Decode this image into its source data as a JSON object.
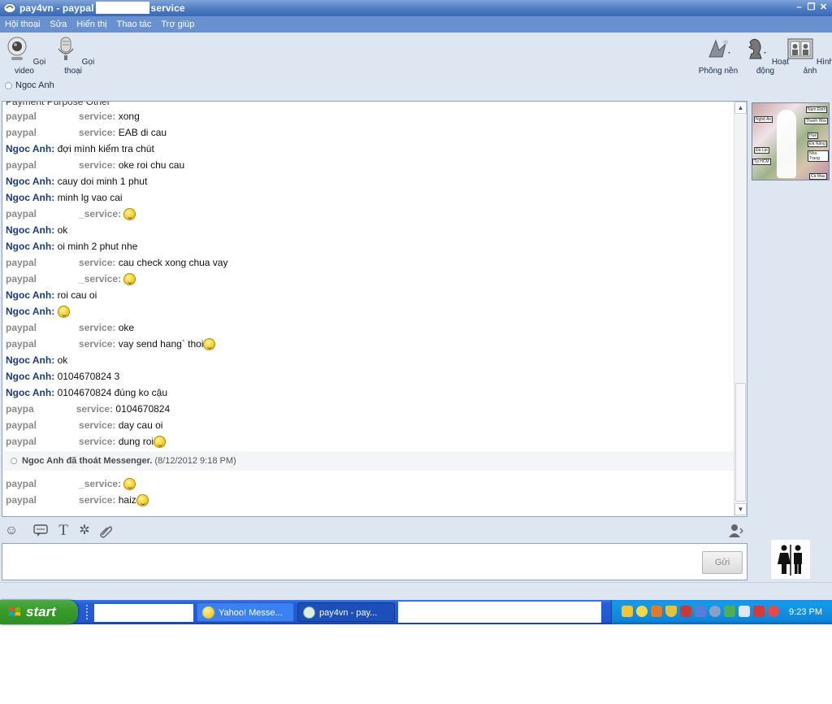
{
  "window": {
    "title": "pay4vn - paypal",
    "title_suffix": "service"
  },
  "menu": [
    "Hội thoại",
    "Sửa",
    "Hiển thị",
    "Thao tác",
    "Trợ giúp"
  ],
  "toolbar": {
    "video_call": "Gọi video",
    "voice_call": "Gọi thoại",
    "background": "Phông nền",
    "activities": "Hoạt động",
    "photos": "Hình ảnh"
  },
  "contact": {
    "name": "Ngoc Anh"
  },
  "conversation": {
    "partial_top": "Payment Purpose Other",
    "messages": [
      {
        "who": "peer",
        "sender": "paypal",
        "suffix": "service:",
        "text": "xong"
      },
      {
        "who": "peer",
        "sender": "paypal",
        "suffix": "service:",
        "text": "EAB di cau"
      },
      {
        "who": "me",
        "sender": "Ngoc Anh:",
        "text": "đợi mình kiểm tra chút"
      },
      {
        "who": "peer",
        "sender": "paypal",
        "suffix": "service:",
        "text": "oke roi chu cau"
      },
      {
        "who": "me",
        "sender": "Ngoc Anh:",
        "text": "cauy doi minh 1 phut"
      },
      {
        "who": "me",
        "sender": "Ngoc Anh:",
        "text": "minh lg vao cai"
      },
      {
        "who": "peer",
        "sender": "paypal",
        "suffix": "_service:",
        "text": "",
        "emoticon": true
      },
      {
        "who": "me",
        "sender": "Ngoc Anh:",
        "text": "ok"
      },
      {
        "who": "me",
        "sender": "Ngoc Anh:",
        "text": "oi minh 2 phut nhe"
      },
      {
        "who": "peer",
        "sender": "paypal",
        "suffix": "service:",
        "text": "cau check xong chua vay"
      },
      {
        "who": "peer",
        "sender": "paypal",
        "suffix": "_service:",
        "text": "",
        "emoticon": true
      },
      {
        "who": "me",
        "sender": "Ngoc Anh:",
        "text": "roi cau oi"
      },
      {
        "who": "me",
        "sender": "Ngoc Anh:",
        "text": "",
        "emoticon": true
      },
      {
        "who": "peer",
        "sender": "paypal",
        "suffix": "service:",
        "text": "oke"
      },
      {
        "who": "peer",
        "sender": "paypal",
        "suffix": "service:",
        "text": "vay send hang` thoi",
        "emoticon": true
      },
      {
        "who": "me",
        "sender": "Ngoc Anh:",
        "text": "ok"
      },
      {
        "who": "me",
        "sender": "Ngoc Anh:",
        "text": "0104670824 3"
      },
      {
        "who": "me",
        "sender": "Ngoc Anh:",
        "text": "0104670824  đúng ko cậu"
      },
      {
        "who": "peer",
        "sender": "paypa",
        "suffix": "service:",
        "text": "0104670824"
      },
      {
        "who": "peer",
        "sender": "paypal",
        "suffix": "service:",
        "text": "day cau oi"
      },
      {
        "who": "peer",
        "sender": "paypal",
        "suffix": "service:",
        "text": "dung roi",
        "emoticon": true
      }
    ],
    "logout_notice": {
      "who": "Ngoc Anh đã thoát Messenger.",
      "when": "(8/12/2012 9:18 PM)"
    },
    "after": [
      {
        "who": "peer",
        "sender": "paypal",
        "suffix": "_service:",
        "text": "",
        "emoticon": true
      },
      {
        "who": "peer",
        "sender": "paypal",
        "suffix": "service:",
        "text": "haiz",
        "emoticon": true
      }
    ]
  },
  "avatar_tags": [
    "Nam Định",
    "Nghệ An",
    "Thanh Hóa",
    "Huế",
    "Đà Nẵng",
    "Đà Lạt",
    "Nha Trang",
    "Tp HCM",
    "Cà Mau"
  ],
  "input": {
    "send_label": "Gửi"
  },
  "taskbar": {
    "start_label": "start",
    "tasks": [
      {
        "label": "Yahoo! Messe...",
        "active": false
      },
      {
        "label": "pay4vn - pay...",
        "active": true
      }
    ],
    "clock": "9:23 PM"
  }
}
